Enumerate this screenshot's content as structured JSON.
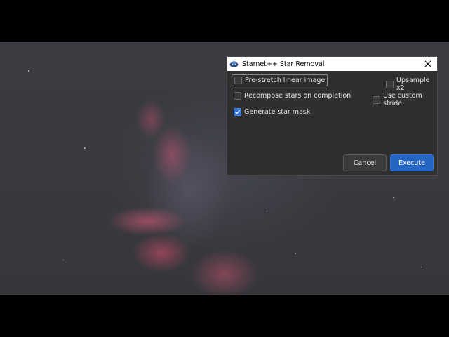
{
  "dialog": {
    "title": "Starnet++ Star Removal",
    "options": {
      "prestretch": {
        "label": "Pre-stretch linear image",
        "checked": false
      },
      "upsample": {
        "label": "Upsample x2",
        "checked": false
      },
      "recompose": {
        "label": "Recompose stars on completion",
        "checked": false
      },
      "custom_stride": {
        "label": "Use custom stride",
        "checked": false
      },
      "star_mask": {
        "label": "Generate star mask",
        "checked": true
      }
    },
    "buttons": {
      "cancel": "Cancel",
      "execute": "Execute"
    }
  },
  "icons": {
    "app": "starnet-app-icon",
    "close": "close-icon",
    "check": "checkmark-icon"
  },
  "colors": {
    "accent": "#2465c4",
    "dialog_bg": "#2f2f2f",
    "titlebar_bg": "#ffffff"
  }
}
